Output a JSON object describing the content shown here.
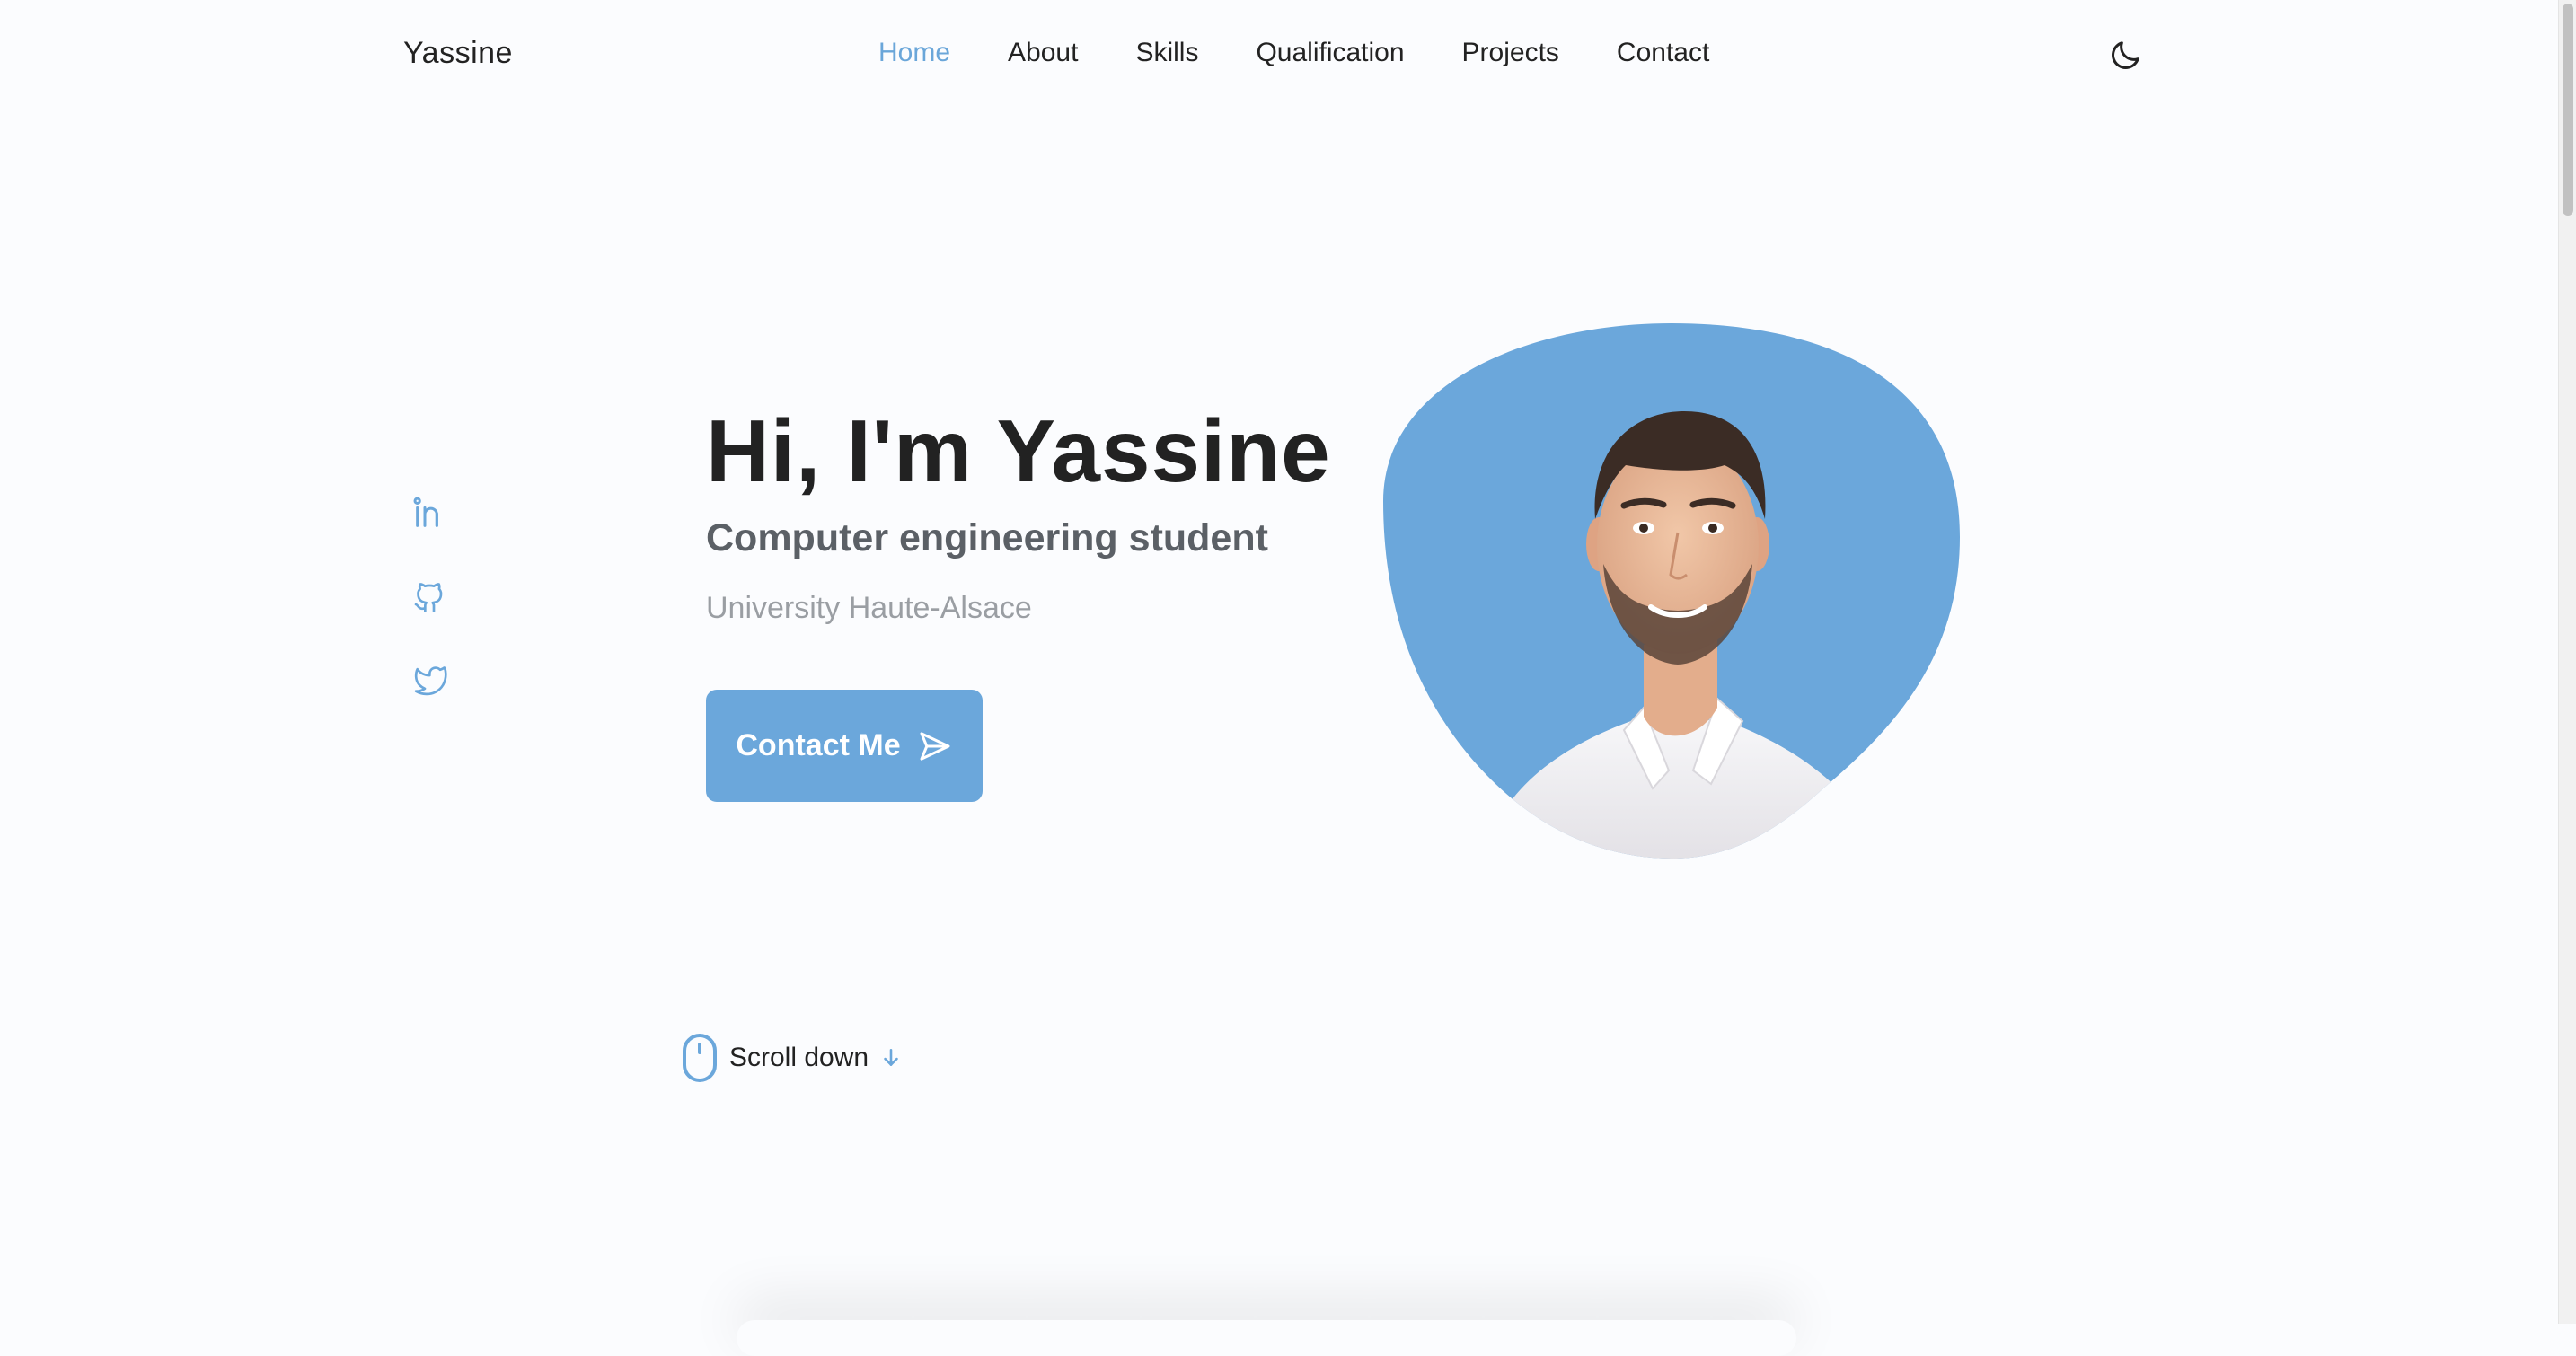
{
  "header": {
    "logo": "Yassine",
    "nav": [
      {
        "label": "Home",
        "active": true
      },
      {
        "label": "About",
        "active": false
      },
      {
        "label": "Skills",
        "active": false
      },
      {
        "label": "Qualification",
        "active": false
      },
      {
        "label": "Projects",
        "active": false
      },
      {
        "label": "Contact",
        "active": false
      }
    ],
    "theme_icon": "moon-icon"
  },
  "social": [
    {
      "icon": "linkedin-icon"
    },
    {
      "icon": "github-icon"
    },
    {
      "icon": "twitter-icon"
    }
  ],
  "hero": {
    "title": "Hi, I'm Yassine",
    "subtitle": "Computer engineering student",
    "description": "University Haute-Alsace",
    "button_label": "Contact Me",
    "button_icon": "send-icon",
    "portrait": "profile-photo"
  },
  "scroll": {
    "label": "Scroll down",
    "mouse_icon": "mouse-icon",
    "arrow_icon": "arrow-down-icon"
  },
  "colors": {
    "accent": "#6ba7db",
    "text": "#222222",
    "subtitle": "#5b6066",
    "muted": "#9a9ea3",
    "background": "#fbfcfe"
  }
}
